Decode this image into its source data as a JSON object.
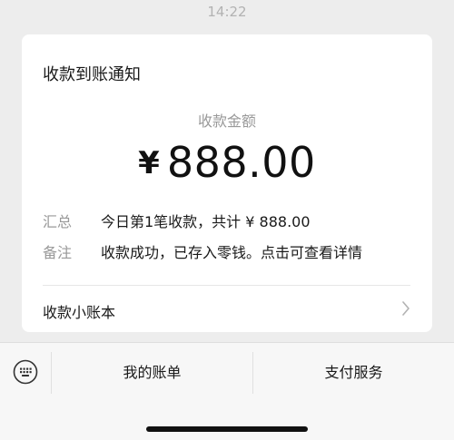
{
  "status_bar": {
    "time": "14:22"
  },
  "card": {
    "title": "收款到账通知",
    "amount_label": "收款金额",
    "currency": "¥",
    "amount": "888.00",
    "details": [
      {
        "key": "汇总",
        "value": "今日第1笔收款，共计 ¥ 888.00"
      },
      {
        "key": "备注",
        "value": "收款成功，已存入零钱。点击可查看详情"
      }
    ],
    "ledger_label": "收款小账本"
  },
  "bottom_menu": {
    "keyboard_icon": "keyboard-icon",
    "items": [
      {
        "label": "我的账单"
      },
      {
        "label": "支付服务"
      }
    ]
  },
  "colors": {
    "background": "#ededed",
    "card": "#ffffff",
    "muted_text": "#999999",
    "primary_text": "#191919"
  }
}
